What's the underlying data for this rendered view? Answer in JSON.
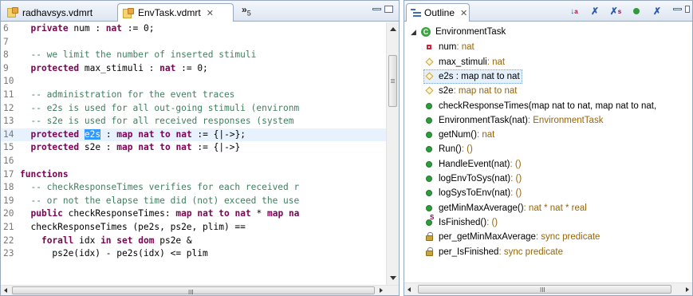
{
  "editor": {
    "tabs": [
      {
        "label": "radhavsys.vdmrt",
        "active": false
      },
      {
        "label": "EnvTask.vdmrt",
        "active": true,
        "close": "✕"
      }
    ],
    "overflow": {
      "symbol": "»",
      "count": "5"
    },
    "lines": [
      {
        "n": "6",
        "segs": [
          {
            "t": "  "
          },
          {
            "t": "private",
            "c": "kw"
          },
          {
            "t": " num : "
          },
          {
            "t": "nat",
            "c": "kw"
          },
          {
            "t": " := 0;"
          }
        ]
      },
      {
        "n": "7",
        "segs": []
      },
      {
        "n": "8",
        "segs": [
          {
            "t": "  -- we limit the number of inserted stimuli",
            "c": "cm"
          }
        ]
      },
      {
        "n": "9",
        "segs": [
          {
            "t": "  "
          },
          {
            "t": "protected",
            "c": "kw"
          },
          {
            "t": " max_stimuli : "
          },
          {
            "t": "nat",
            "c": "kw"
          },
          {
            "t": " := 0;"
          }
        ]
      },
      {
        "n": "10",
        "segs": []
      },
      {
        "n": "11",
        "segs": [
          {
            "t": "  -- administration for the event traces",
            "c": "cm"
          }
        ]
      },
      {
        "n": "12",
        "segs": [
          {
            "t": "  -- e2s is used for all out-going stimuli (environm",
            "c": "cm"
          }
        ]
      },
      {
        "n": "13",
        "segs": [
          {
            "t": "  -- s2e is used for all received responses (system",
            "c": "cm"
          }
        ]
      },
      {
        "n": "14",
        "current": true,
        "segs": [
          {
            "t": "  "
          },
          {
            "t": "protected",
            "c": "kw"
          },
          {
            "t": " "
          },
          {
            "t": "e2s",
            "c": "sel"
          },
          {
            "t": " : "
          },
          {
            "t": "map",
            "c": "kw"
          },
          {
            "t": " "
          },
          {
            "t": "nat",
            "c": "kw"
          },
          {
            "t": " "
          },
          {
            "t": "to",
            "c": "kw"
          },
          {
            "t": " "
          },
          {
            "t": "nat",
            "c": "kw"
          },
          {
            "t": " := {|->};"
          }
        ]
      },
      {
        "n": "15",
        "segs": [
          {
            "t": "  "
          },
          {
            "t": "protected",
            "c": "kw"
          },
          {
            "t": " s2e : "
          },
          {
            "t": "map",
            "c": "kw"
          },
          {
            "t": " "
          },
          {
            "t": "nat",
            "c": "kw"
          },
          {
            "t": " "
          },
          {
            "t": "to",
            "c": "kw"
          },
          {
            "t": " "
          },
          {
            "t": "nat",
            "c": "kw"
          },
          {
            "t": " := {|->}"
          }
        ]
      },
      {
        "n": "16",
        "segs": []
      },
      {
        "n": "17",
        "segs": [
          {
            "t": "functions",
            "c": "kw"
          }
        ]
      },
      {
        "n": "18",
        "segs": [
          {
            "t": "  -- checkResponseTimes verifies for each received r",
            "c": "cm"
          }
        ]
      },
      {
        "n": "19",
        "segs": [
          {
            "t": "  -- or not the elapse time did (not) exceed the use",
            "c": "cm"
          }
        ]
      },
      {
        "n": "20",
        "segs": [
          {
            "t": "  "
          },
          {
            "t": "public",
            "c": "kw"
          },
          {
            "t": " checkResponseTimes: "
          },
          {
            "t": "map",
            "c": "kw"
          },
          {
            "t": " "
          },
          {
            "t": "nat",
            "c": "kw"
          },
          {
            "t": " "
          },
          {
            "t": "to",
            "c": "kw"
          },
          {
            "t": " "
          },
          {
            "t": "nat",
            "c": "kw"
          },
          {
            "t": " * "
          },
          {
            "t": "map",
            "c": "kw"
          },
          {
            "t": " "
          },
          {
            "t": "na",
            "c": "kw"
          }
        ]
      },
      {
        "n": "21",
        "segs": [
          {
            "t": "  checkResponseTimes (pe2s, ps2e, plim) =="
          }
        ]
      },
      {
        "n": "22",
        "segs": [
          {
            "t": "    "
          },
          {
            "t": "forall",
            "c": "kw"
          },
          {
            "t": " idx "
          },
          {
            "t": "in",
            "c": "kw"
          },
          {
            "t": " "
          },
          {
            "t": "set",
            "c": "kw"
          },
          {
            "t": " "
          },
          {
            "t": "dom",
            "c": "kw"
          },
          {
            "t": " ps2e &"
          }
        ]
      },
      {
        "n": "23",
        "segs": [
          {
            "t": "      ps2e(idx) - pe2s(idx) <= plim"
          }
        ]
      }
    ],
    "hscroll_grip": "III"
  },
  "outline": {
    "title": "Outline",
    "close": "✕",
    "tools": [
      "sort-icon",
      "hide-fields-icon",
      "hide-static-icon",
      "hide-nonpublic-icon",
      "hide-local-types-icon"
    ],
    "root": {
      "label": "EnvironmentTask",
      "icon": "C"
    },
    "items": [
      {
        "icon": "square",
        "label": "num",
        "type": " : nat"
      },
      {
        "icon": "diamond",
        "label": "max_stimuli",
        "type": " : nat"
      },
      {
        "icon": "diamond",
        "label": "e2s : map nat to nat",
        "type": "",
        "selected": true
      },
      {
        "icon": "diamond",
        "label": "s2e",
        "type": " : map nat to nat"
      },
      {
        "icon": "dot",
        "label": "checkResponseTimes(map nat to nat, map nat to nat,",
        "type": ""
      },
      {
        "icon": "dot",
        "label": "EnvironmentTask(nat)",
        "type": " : EnvironmentTask"
      },
      {
        "icon": "dot",
        "label": "getNum()",
        "type": " : nat"
      },
      {
        "icon": "dot",
        "label": "Run()",
        "type": " : ()"
      },
      {
        "icon": "dot",
        "label": "HandleEvent(nat)",
        "type": " : ()"
      },
      {
        "icon": "dot",
        "label": "logEnvToSys(nat)",
        "type": " : ()"
      },
      {
        "icon": "dot",
        "label": "logSysToEnv(nat)",
        "type": " : ()"
      },
      {
        "icon": "dot",
        "label": "getMinMaxAverage()",
        "type": " : nat * nat * real"
      },
      {
        "icon": "dot-static",
        "label": "IsFinished()",
        "type": " : ()"
      },
      {
        "icon": "lock",
        "label": "per_getMinMaxAverage",
        "type": " : sync predicate"
      },
      {
        "icon": "lock",
        "label": "per_IsFinished",
        "type": " : sync predicate"
      }
    ],
    "hscroll_grip": "III"
  }
}
